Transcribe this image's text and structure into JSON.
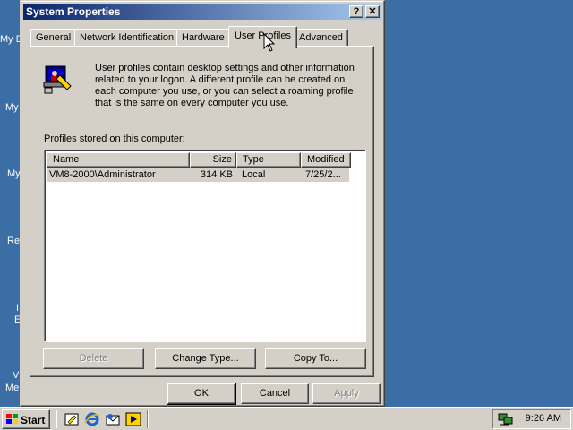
{
  "desktop": {
    "icon_labels": [
      "My D",
      "My",
      "My",
      "Re",
      "I",
      "E",
      "V",
      "Me"
    ]
  },
  "window": {
    "title": "System Properties",
    "help_button": "?",
    "close_button": "✕"
  },
  "tabs": [
    {
      "label": "General",
      "active": false
    },
    {
      "label": "Network Identification",
      "active": false
    },
    {
      "label": "Hardware",
      "active": false
    },
    {
      "label": "User Profiles",
      "active": true
    },
    {
      "label": "Advanced",
      "active": false
    }
  ],
  "user_profiles": {
    "intro": "User profiles contain desktop settings and other information related to your logon.  A different profile can be created on each computer you use, or you can select a roaming profile that is the same on every computer you use.",
    "list_label": "Profiles stored on this computer:",
    "columns": [
      "Name",
      "Size",
      "Type",
      "Modified"
    ],
    "rows": [
      {
        "name": "VM8-2000\\Administrator",
        "size": "314 KB",
        "type": "Local",
        "modified": "7/25/2..."
      }
    ],
    "buttons": {
      "delete": "Delete",
      "change_type": "Change Type...",
      "copy_to": "Copy To..."
    }
  },
  "dialog_buttons": {
    "ok": "OK",
    "cancel": "Cancel",
    "apply": "Apply"
  },
  "taskbar": {
    "start": "Start",
    "clock": "9:26 AM"
  },
  "colors": {
    "desktop": "#3a6ea5",
    "title_start": "#0a246a",
    "title_end": "#a6caf0",
    "face": "#d4d0c8"
  }
}
